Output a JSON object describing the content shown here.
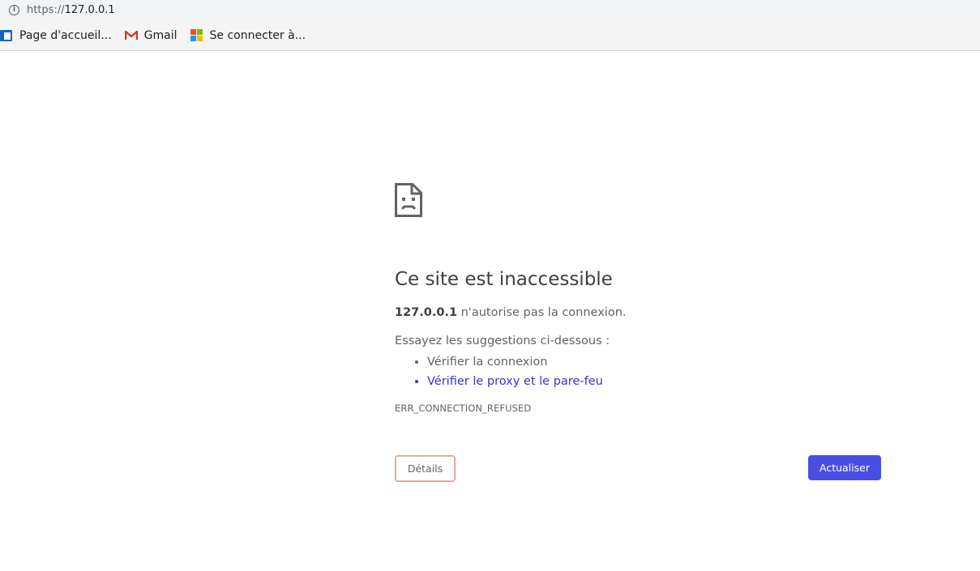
{
  "address_bar": {
    "scheme": "https://",
    "host": "127.0.0.1"
  },
  "bookmarks": [
    {
      "label": "Page d'accueil...",
      "icon": "home-page-icon"
    },
    {
      "label": "Gmail",
      "icon": "gmail-icon"
    },
    {
      "label": "Se connecter à...",
      "icon": "microsoft-icon"
    }
  ],
  "error_page": {
    "title": "Ce site est inaccessible",
    "host_bold": "127.0.0.1",
    "message_rest": " n'autorise pas la connexion.",
    "suggestions_heading": "Essayez les suggestions ci-dessous :",
    "suggestions": [
      "Vérifier la connexion",
      "Vérifier le proxy et le pare-feu"
    ],
    "error_code": "ERR_CONNECTION_REFUSED",
    "details_button": "Détails",
    "reload_button": "Actualiser"
  },
  "colors": {
    "accent_button": "#4a4fe3",
    "link": "#3c2fd0",
    "gmail_red": "#d93025"
  }
}
